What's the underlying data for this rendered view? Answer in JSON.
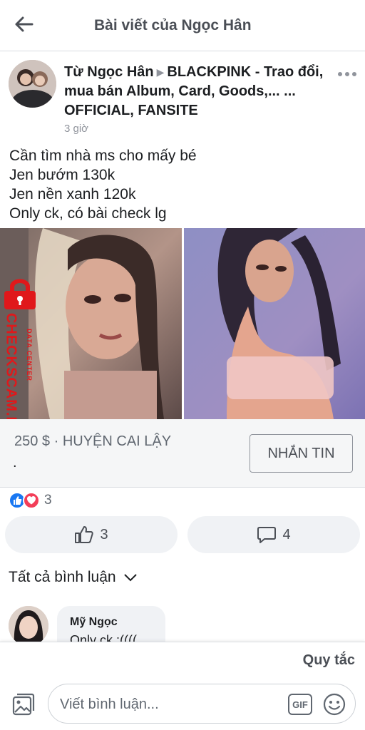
{
  "header": {
    "title": "Bài viết của Ngọc Hân"
  },
  "post": {
    "author": "Từ Ngọc Hân",
    "group": "BLACKPINK - Trao đổi, mua bán Album, Card, Goods,... ... OFFICIAL, FANSITE",
    "time": "3 giờ",
    "lines": [
      "Cần tìm nhà ms cho mấy bé",
      "Jen bướm 130k",
      "Jen nền xanh 120k",
      "Only ck, có bài check lg"
    ]
  },
  "watermark": {
    "brand": "CHECKSCAM.INFO",
    "tagline": "DATA CENTER",
    "color": "#e0181b"
  },
  "marketplace": {
    "price_location": "250 $ · HUYỆN CAI LẬY",
    "extra": ".",
    "message_button": "NHẮN TIN"
  },
  "reactions": {
    "count": "3"
  },
  "actions": {
    "like_count": "3",
    "comment_count": "4"
  },
  "comments": {
    "toggle_label": "Tất cả bình luận",
    "items": [
      {
        "name": "Mỹ Ngọc",
        "text": "Only ck :(((("
      }
    ]
  },
  "footer": {
    "rules_label": "Quy tắc",
    "input_placeholder": "Viết bình luận...",
    "gif_label": "GIF"
  },
  "colors": {
    "like": "#1877f2",
    "love": "#f33e58",
    "text_secondary": "#606770"
  }
}
